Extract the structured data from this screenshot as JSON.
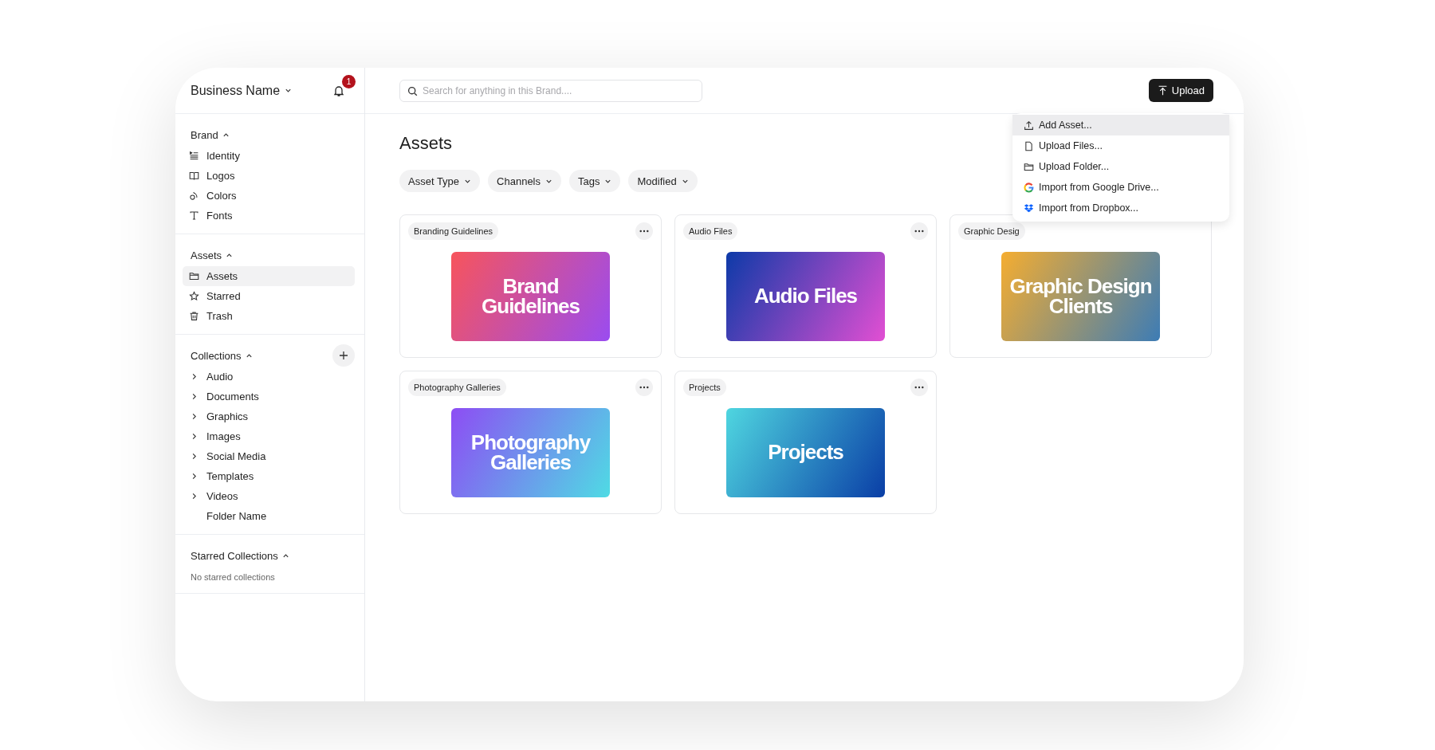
{
  "workspace": {
    "name": "Business Name",
    "notifications": "1"
  },
  "sidebar": {
    "sections": [
      {
        "title": "Brand",
        "expanded": true,
        "items": [
          {
            "label": "Identity",
            "kind": "identity",
            "selected": false
          },
          {
            "label": "Logos",
            "kind": "book",
            "selected": false
          },
          {
            "label": "Colors",
            "kind": "drops",
            "selected": false
          },
          {
            "label": "Fonts",
            "kind": "type",
            "selected": false
          }
        ]
      },
      {
        "title": "Assets",
        "expanded": true,
        "items": [
          {
            "label": "Assets",
            "kind": "folder",
            "selected": true
          },
          {
            "label": "Starred",
            "kind": "star",
            "selected": false
          },
          {
            "label": "Trash",
            "kind": "trash",
            "selected": false
          }
        ]
      },
      {
        "title": "Collections",
        "expanded": true,
        "add_button": true,
        "items": [
          {
            "label": "Audio",
            "kind": "chevron",
            "selected": false
          },
          {
            "label": "Documents",
            "kind": "chevron",
            "selected": false
          },
          {
            "label": "Graphics",
            "kind": "chevron",
            "selected": false
          },
          {
            "label": "Images",
            "kind": "chevron",
            "selected": false
          },
          {
            "label": "Social Media",
            "kind": "chevron",
            "selected": false
          },
          {
            "label": "Templates",
            "kind": "chevron",
            "selected": false
          },
          {
            "label": "Videos",
            "kind": "chevron",
            "selected": false
          },
          {
            "label": "Folder Name",
            "kind": "folder-leaf",
            "selected": false
          }
        ]
      },
      {
        "title": "Starred Collections",
        "expanded": true,
        "empty_text": "No starred collections"
      }
    ]
  },
  "search": {
    "placeholder": "Search for anything in this Brand...."
  },
  "upload_button": "Upload",
  "page_title": "Assets",
  "filters": [
    "Asset Type",
    "Channels",
    "Tags",
    "Modified"
  ],
  "cards": [
    {
      "label": "Branding Guidelines",
      "more": true,
      "thumbnail": "Brand Guidelines"
    },
    {
      "label": "Audio Files",
      "more": true,
      "thumbnail": "Audio Files"
    },
    {
      "label": "Graphic Desig",
      "more": false,
      "thumbnail": "Graphic Design Clients"
    },
    {
      "label": "Photography Galleries",
      "more": true,
      "thumbnail": "Photography Galleries"
    },
    {
      "label": "Projects",
      "more": true,
      "thumbnail": "Projects"
    }
  ],
  "upload_menu": [
    {
      "label": "Add Asset...",
      "kind": "upload",
      "selected": true
    },
    {
      "label": "Upload Files...",
      "kind": "file",
      "selected": false
    },
    {
      "label": "Upload Folder...",
      "kind": "folder",
      "selected": false
    },
    {
      "label": "Import from Google Drive...",
      "kind": "google",
      "selected": false
    },
    {
      "label": "Import from Dropbox...",
      "kind": "dropbox",
      "selected": false
    }
  ]
}
